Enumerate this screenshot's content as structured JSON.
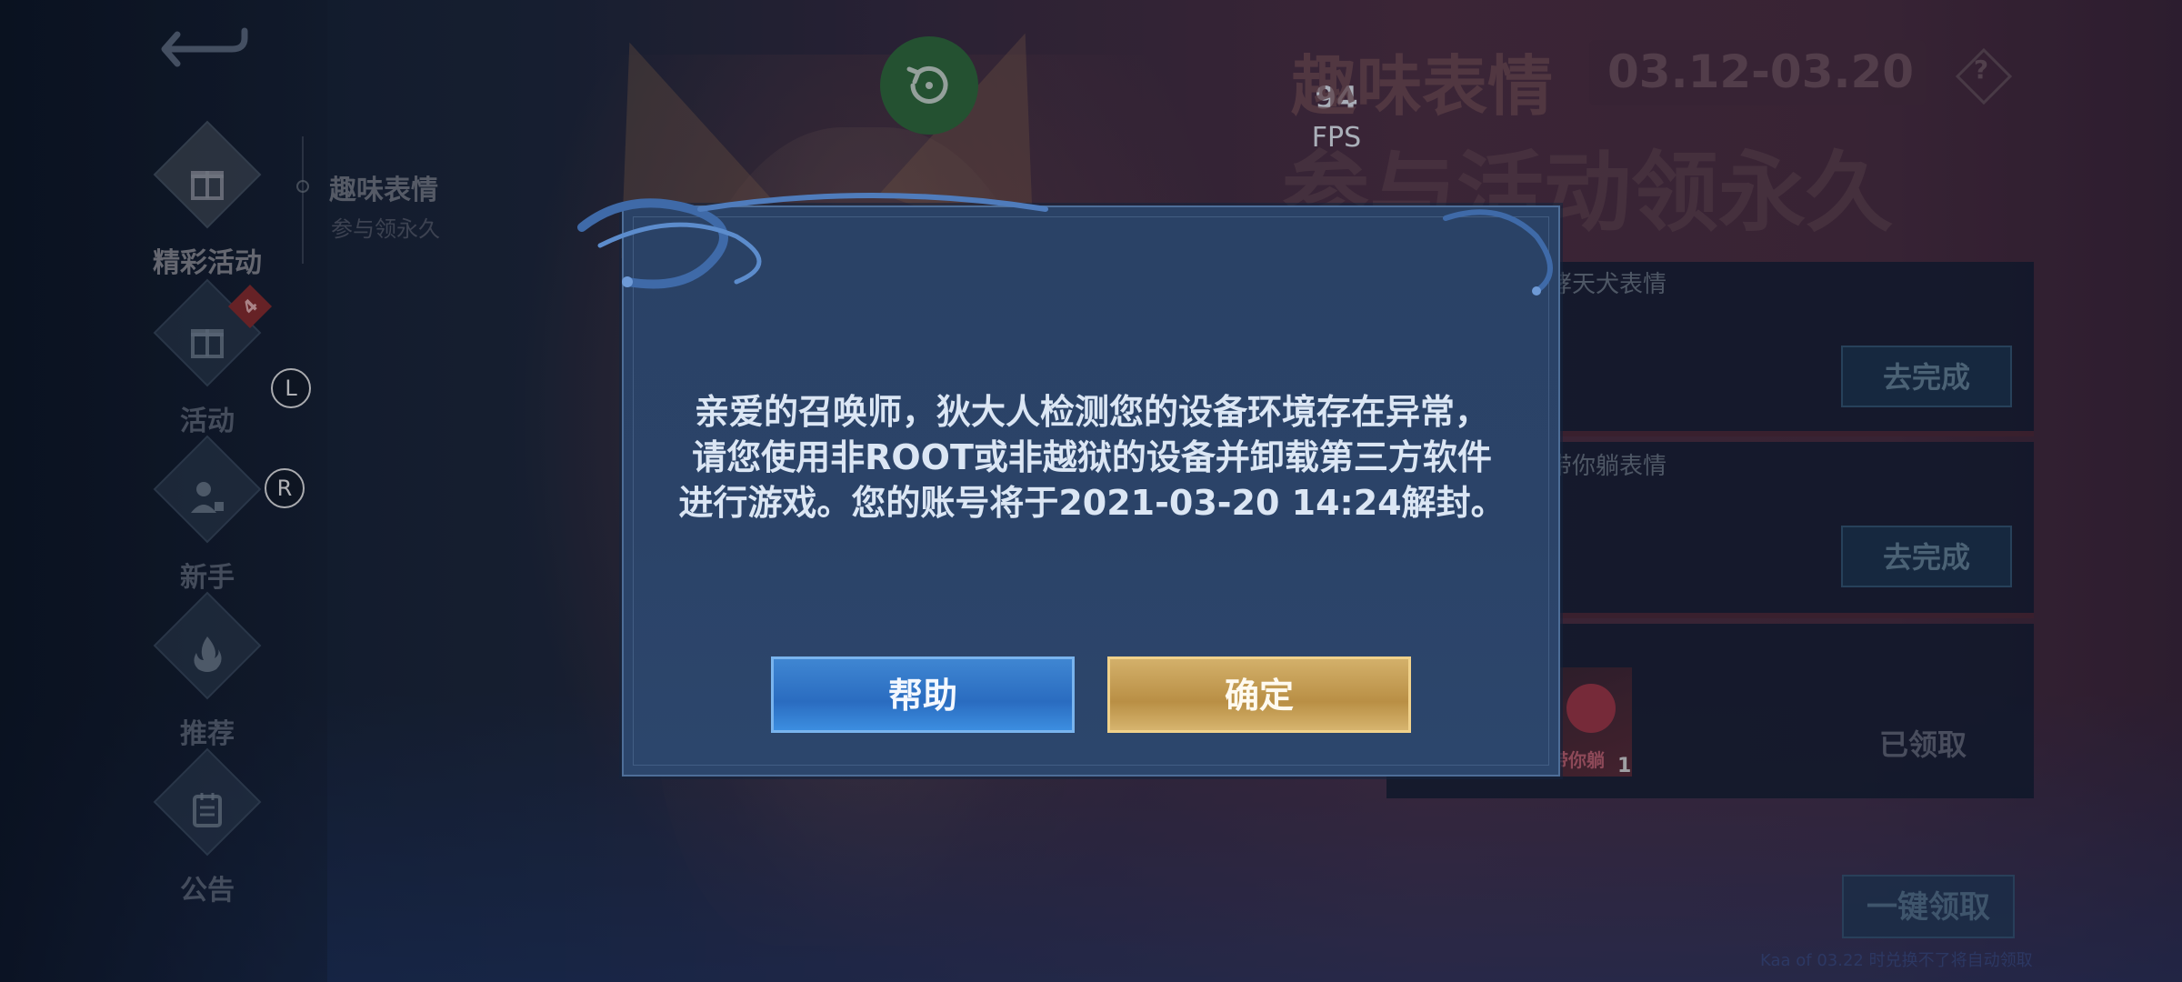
{
  "overlay": {
    "fps_value": "94",
    "fps_label": "FPS",
    "left_key": "L",
    "right_key": "R"
  },
  "sidebar": {
    "items": [
      {
        "label": "精彩活动",
        "icon": "gift-icon",
        "active": true
      },
      {
        "label": "活动",
        "icon": "gift-icon",
        "badge": "4"
      },
      {
        "label": "新手",
        "icon": "user-icon"
      },
      {
        "label": "推荐",
        "icon": "flame-icon"
      },
      {
        "label": "公告",
        "icon": "calendar-icon"
      }
    ],
    "sub": {
      "title": "趣味表情",
      "subtitle": "参与领永久"
    }
  },
  "event": {
    "title": "趣味表情",
    "date_range": "03.12-03.20",
    "slogan": "参与活动领永久",
    "help_icon": "?",
    "tasks": [
      {
        "name": "哮天犬表情",
        "action": "去完成"
      },
      {
        "name": "带你躺表情",
        "action": "去完成"
      },
      {
        "reward_label": "带你躺",
        "reward_count": "1",
        "action": "已领取"
      }
    ],
    "claim_all": "一键领取",
    "footnote": "Kaa of 03.22 时兑换不了将自动领取"
  },
  "dialog": {
    "message_line1": "亲爱的召唤师，狄大人检测您的设备环境存在异常，",
    "message_line2": "请您使用非ROOT或非越狱的设备并卸载第三方软件",
    "message_line3": "进行游戏。您的账号将于2021-03-20 14:24解封。",
    "help_button": "帮助",
    "confirm_button": "确定"
  },
  "colors": {
    "dialog_bg": "#2b4368",
    "dialog_text": "#dbe6f4",
    "help_button": "#2f75c8",
    "confirm_button": "#c49d52"
  }
}
